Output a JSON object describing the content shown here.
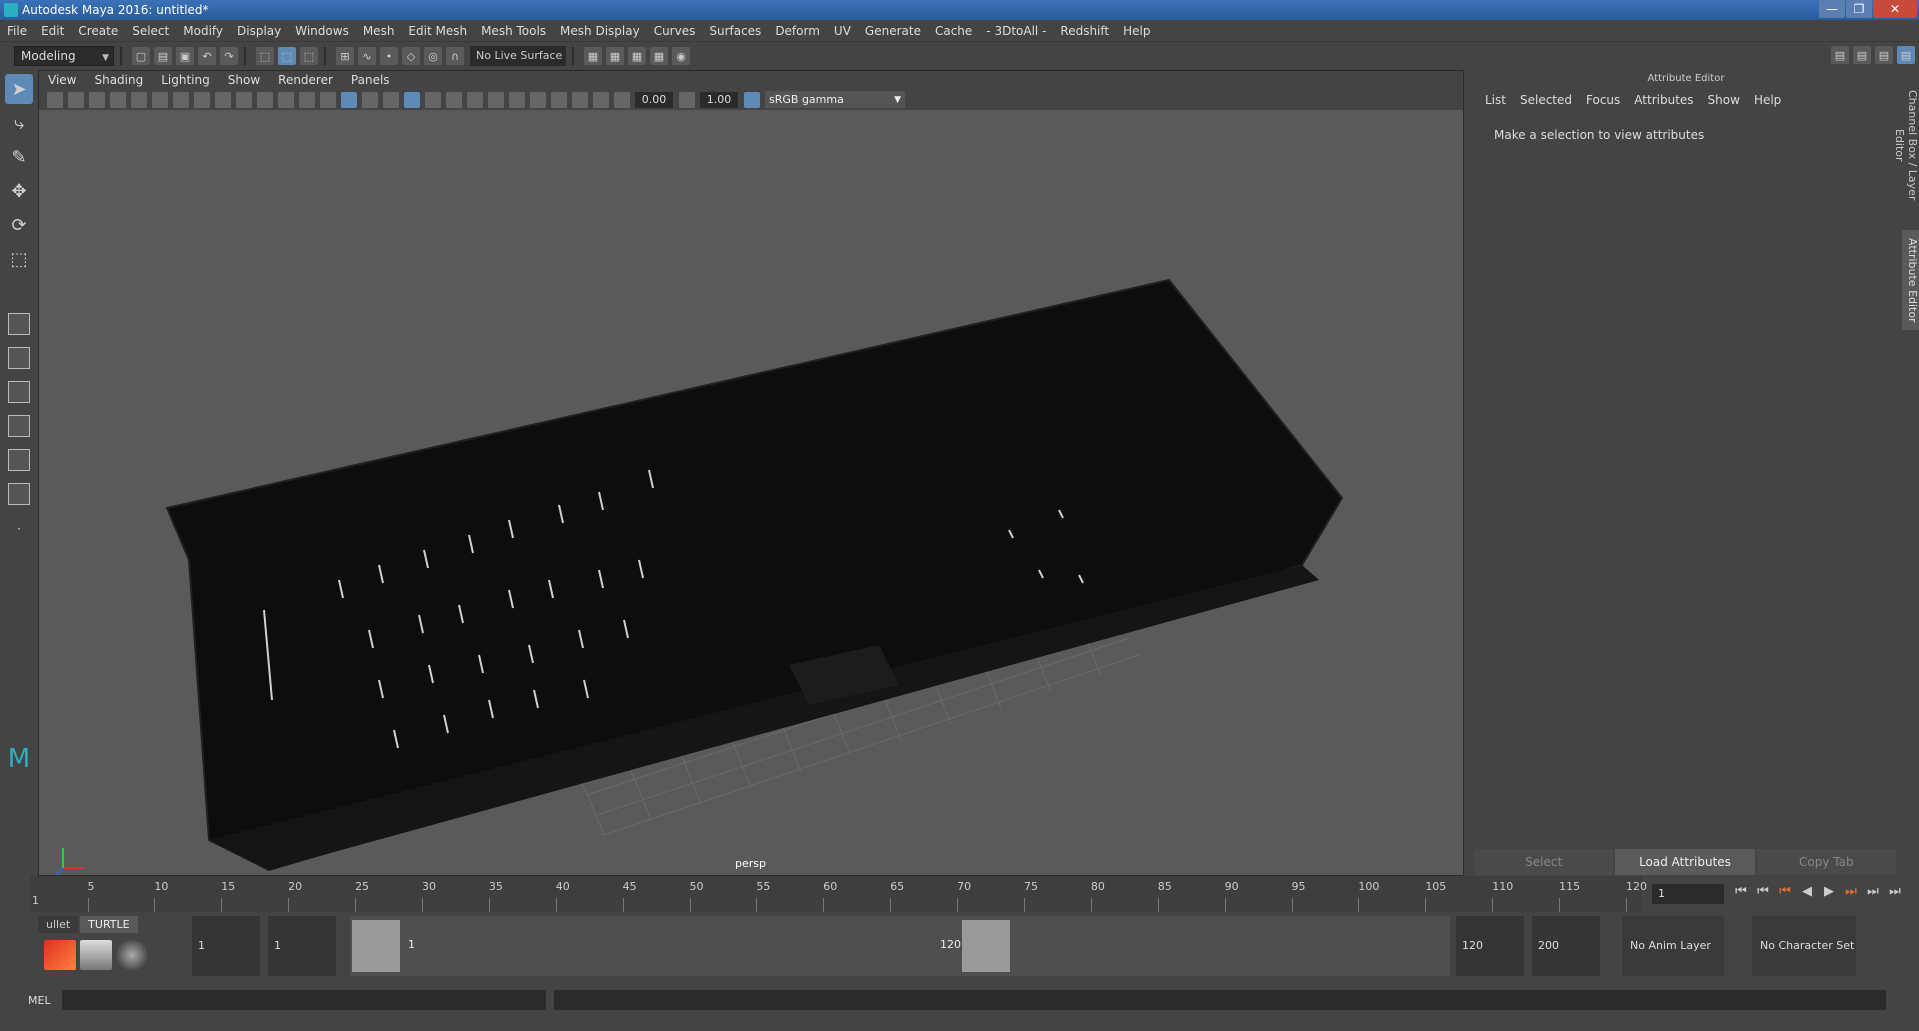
{
  "window": {
    "title": "Autodesk Maya 2016: untitled*",
    "controls": [
      "—",
      "❐",
      "✕"
    ]
  },
  "menubar": [
    "File",
    "Edit",
    "Create",
    "Select",
    "Modify",
    "Display",
    "Windows",
    "Mesh",
    "Edit Mesh",
    "Mesh Tools",
    "Mesh Display",
    "Curves",
    "Surfaces",
    "Deform",
    "UV",
    "Generate",
    "Cache",
    "- 3DtoAll -",
    "Redshift",
    "Help"
  ],
  "toolbar": {
    "mode": "Modeling",
    "live_surface": "No Live Surface"
  },
  "panel": {
    "menu": [
      "View",
      "Shading",
      "Lighting",
      "Show",
      "Renderer",
      "Panels"
    ],
    "exposure": "0.00",
    "gamma": "1.00",
    "color_space": "sRGB gamma",
    "camera_label": "persp"
  },
  "attribute_editor": {
    "title": "Attribute Editor",
    "menu": [
      "List",
      "Selected",
      "Focus",
      "Attributes",
      "Show",
      "Help"
    ],
    "message": "Make a selection to view attributes",
    "buttons": [
      "Select",
      "Load Attributes",
      "Copy Tab"
    ]
  },
  "side_tabs": [
    "Channel Box / Layer Editor",
    "Attribute Editor"
  ],
  "timeslider": {
    "start_tick": "1",
    "tick_labels": [
      "5",
      "10",
      "15",
      "20",
      "25",
      "30",
      "35",
      "40",
      "45",
      "50",
      "55",
      "60",
      "65",
      "70",
      "75",
      "80",
      "85",
      "90",
      "95",
      "100",
      "105",
      "110",
      "115",
      "120"
    ],
    "current_frame": "1",
    "playback_icons": [
      "⏮",
      "⏮",
      "⏮",
      "◀",
      "▶",
      "⏭",
      "⏭",
      "⏭"
    ]
  },
  "range": {
    "shelf_tabs": [
      "ullet",
      "TURTLE"
    ],
    "start_time": "1",
    "playback_start": "1",
    "range_start": "1",
    "range_end": "120",
    "playback_end": "120",
    "end_time": "200",
    "anim_layer": "No Anim Layer",
    "character_set": "No Character Set"
  },
  "cmdline": {
    "label": "MEL"
  },
  "colors": {
    "accent": "#5d8ab7",
    "viewport_bg": "#5a5a5a",
    "panel_bg": "#444444"
  }
}
